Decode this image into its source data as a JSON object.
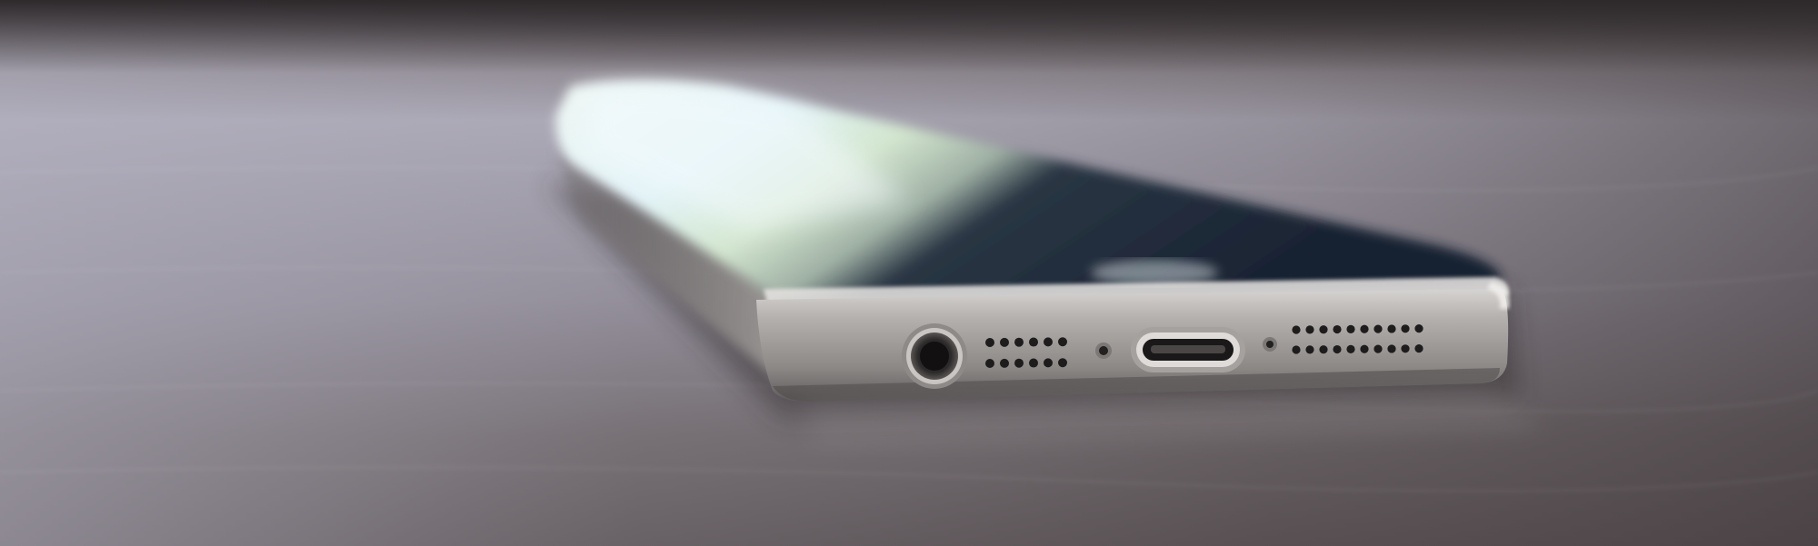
{
  "scene": {
    "subject": "smartphone",
    "surface": "wooden-table",
    "palette": {
      "background_top": "#3a3436",
      "table_light": "#b8b5c2",
      "table_dark": "#5e5658",
      "device_frame": "#9c9897",
      "screen_glow": "#eaf6f8",
      "screen_dark": "#1c2632",
      "port_dark": "#2a2828"
    }
  }
}
